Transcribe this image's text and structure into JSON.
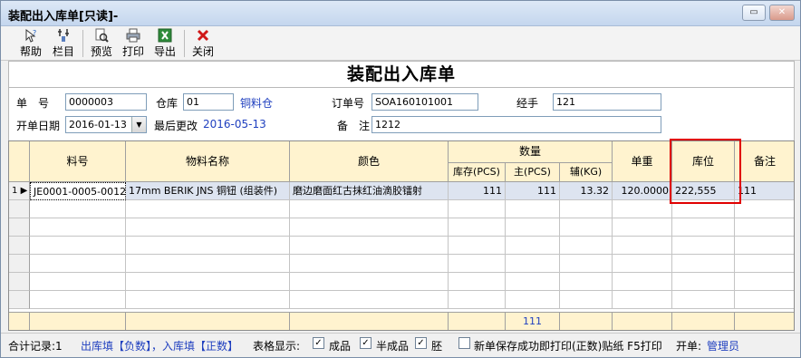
{
  "window": {
    "title": "装配出入库单[只读]-",
    "restore_icon": "restore-icon",
    "close_icon": "close-icon"
  },
  "toolbar": {
    "items": [
      {
        "label": "帮助",
        "icon": "help-icon"
      },
      {
        "label": "栏目",
        "icon": "columns-icon"
      },
      {
        "label": "预览",
        "icon": "preview-icon"
      },
      {
        "label": "打印",
        "icon": "print-icon"
      },
      {
        "label": "导出",
        "icon": "excel-export-icon"
      },
      {
        "label": "关闭",
        "icon": "close-x-icon"
      }
    ]
  },
  "document_title": "装配出入库单",
  "form": {
    "doc_no_label": "单　号",
    "doc_no": "0000003",
    "warehouse_label": "仓库",
    "warehouse_code": "01",
    "warehouse_name": "铜料仓",
    "order_no_label": "订单号",
    "order_no": "SOA160101001",
    "handler_label": "经手",
    "handler": "121",
    "open_date_label": "开单日期",
    "open_date": "2016-01-13",
    "last_modified_label": "最后更改",
    "last_modified": "2016-05-13",
    "remark_label": "备　注",
    "remark": "1212"
  },
  "grid": {
    "headers": {
      "item_no": "料号",
      "item_name": "物料名称",
      "color": "颜色",
      "quantity": "数量",
      "stock": "库存(PCS)",
      "main": "主(PCS)",
      "aux": "辅(KG)",
      "unit_weight": "单重",
      "location": "库位",
      "note": "备注"
    },
    "rows": [
      {
        "index": "1",
        "item_no": "JE0001-0005-0012",
        "item_name": "17mm BERIK JNS 铜钮 (组装件)",
        "color": "磨边磨面红古抹红油滴胶镭射",
        "stock": "111",
        "main": "111",
        "aux": "13.32",
        "unit_weight": "120.0000",
        "location": "222,555",
        "note": "111"
      }
    ],
    "footer_main_total": "111"
  },
  "status": {
    "total_label": "合计记录:1",
    "hint": "出库填【负数】，入库填【正数】",
    "display_label": "表格显示:",
    "finished_label": "成品",
    "finished_checked": true,
    "semi_label": "半成品",
    "semi_checked": true,
    "blank_label": "胚",
    "blank_checked": true,
    "print_label": "新单保存成功即打印(正数)贴纸 F5打印",
    "print_checked": false,
    "opener_label": "开单:",
    "opener": "管理员"
  }
}
